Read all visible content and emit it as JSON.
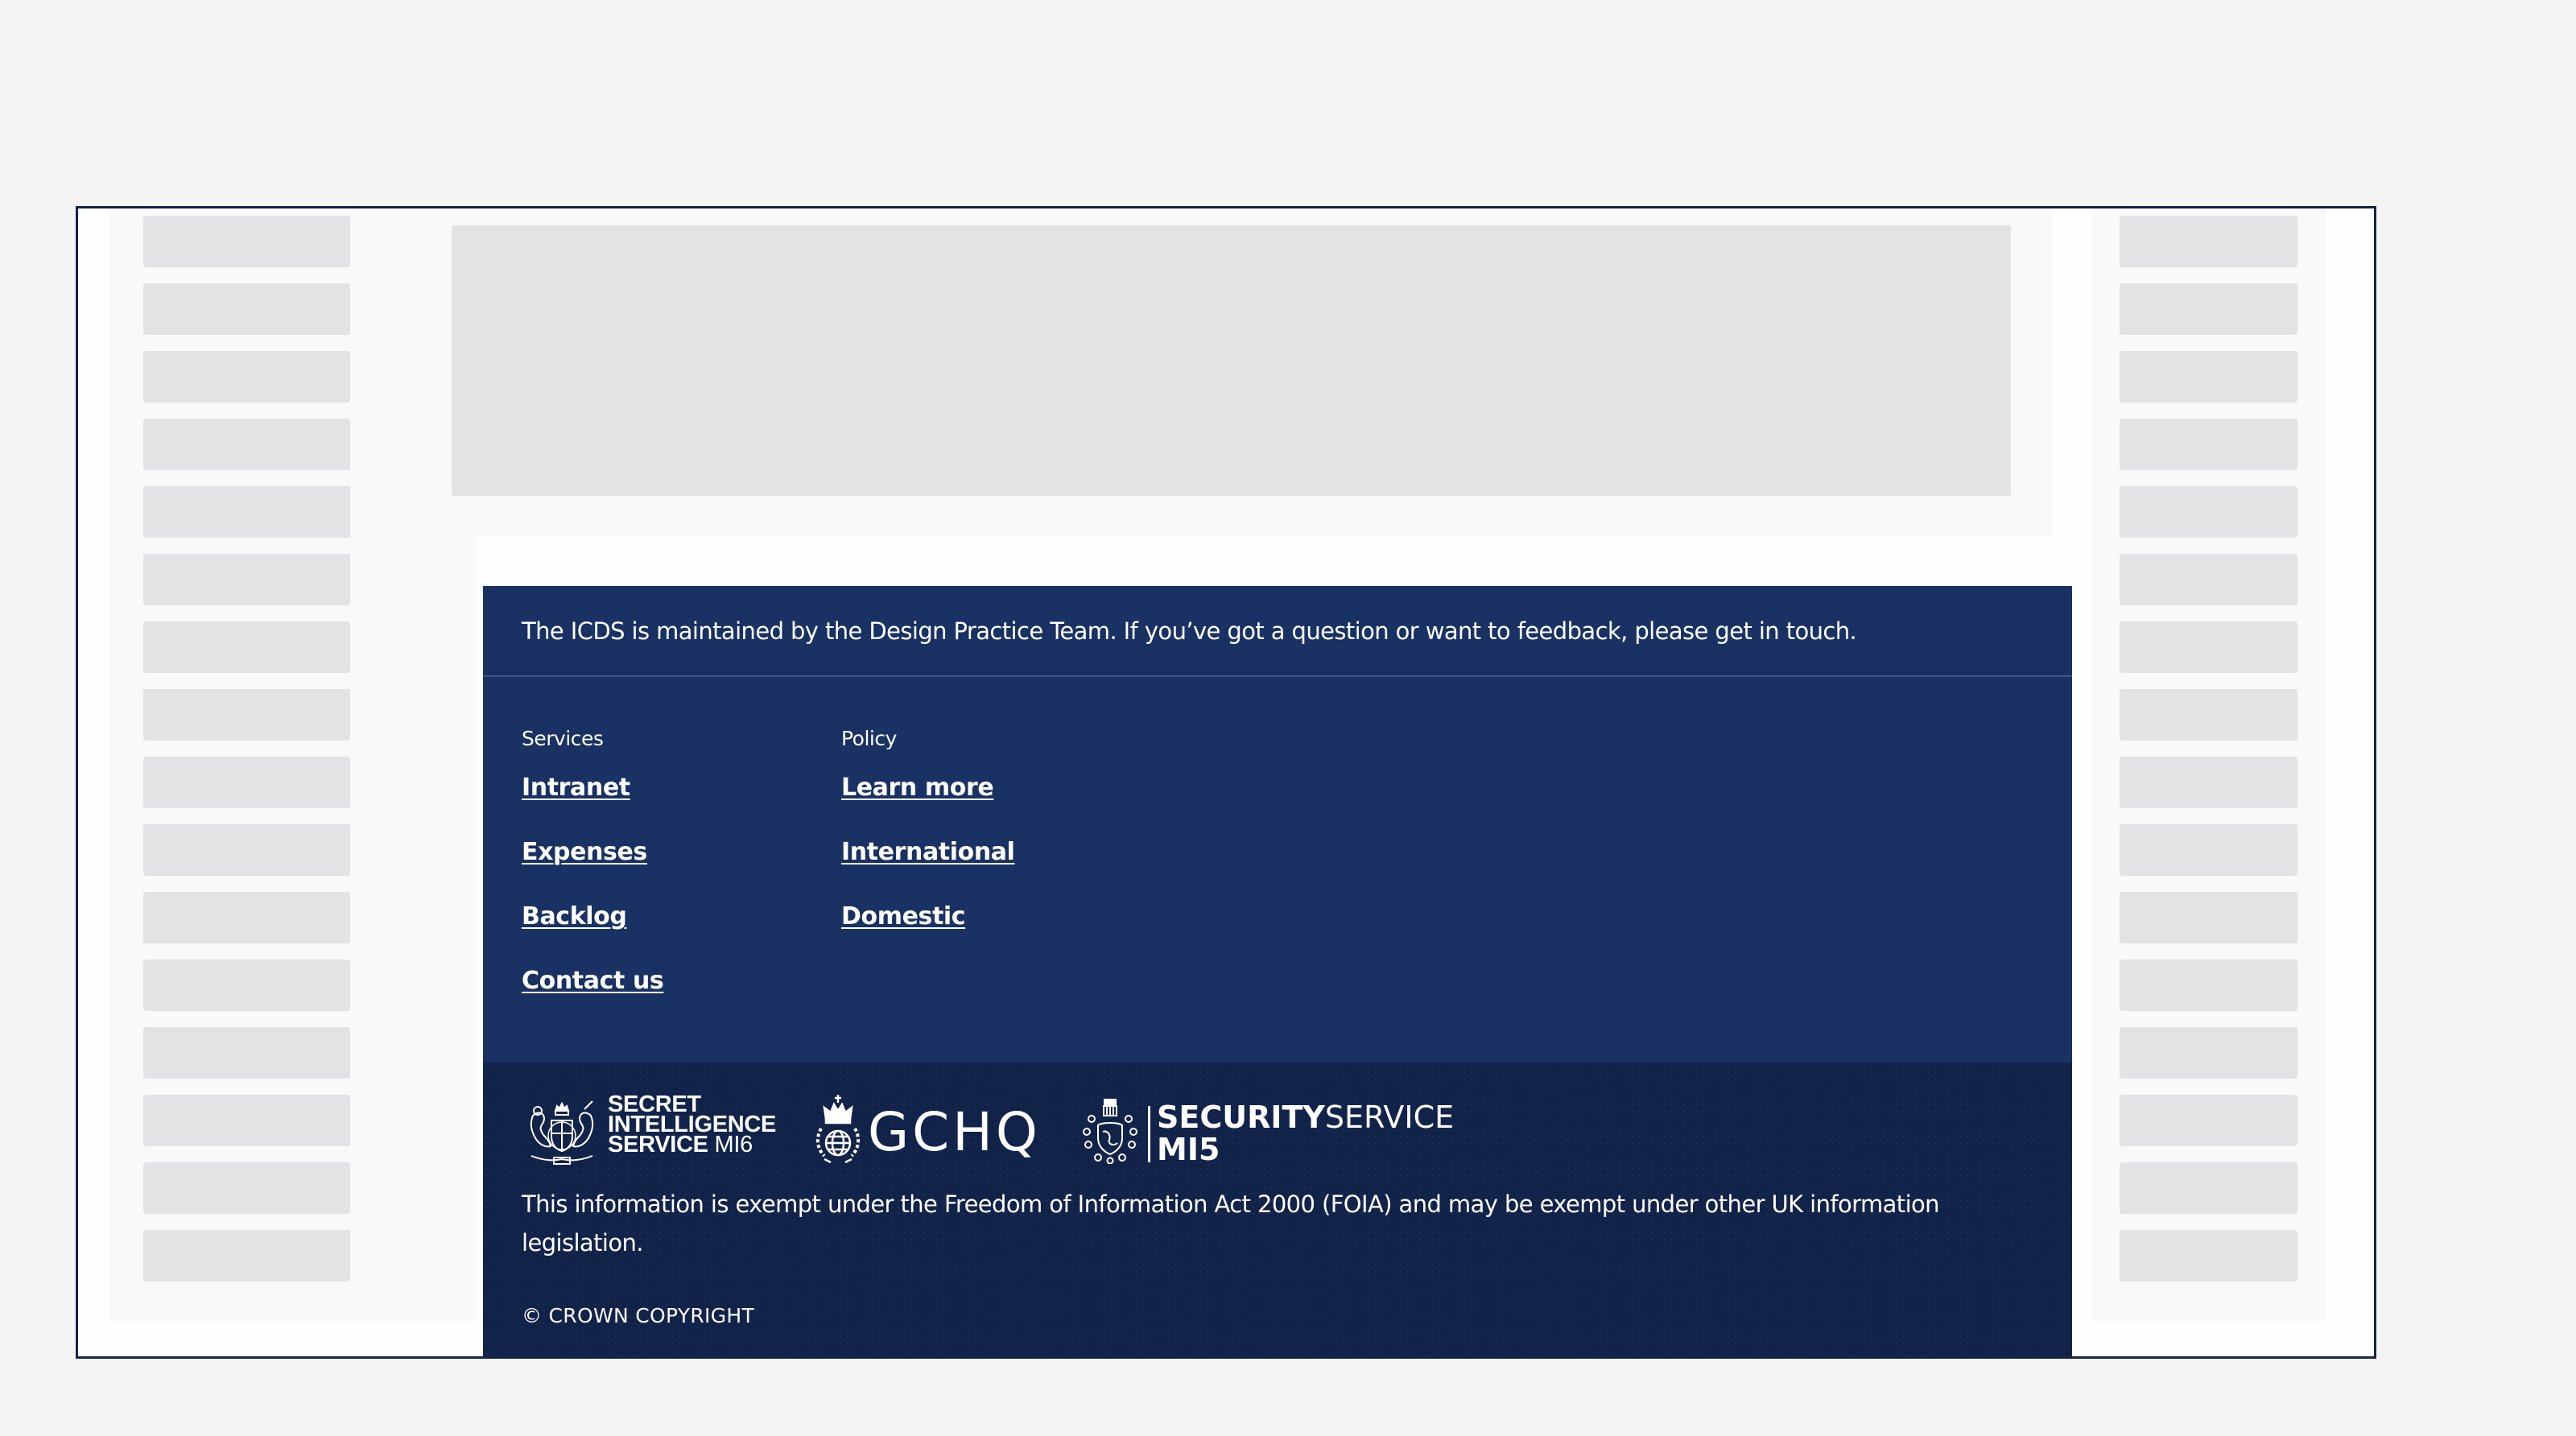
{
  "layout": {
    "left_sidebar_item_count": 16,
    "right_sidebar_item_count": 16
  },
  "colors": {
    "page_background": "#f4f4f4",
    "frame_border": "#14244a",
    "skeleton": "#e2e3e4",
    "footer_primary": "#193163",
    "footer_secondary": "#12234a",
    "footer_text": "#ffffff"
  },
  "footer": {
    "intro": "The ICDS is maintained by the Design Practice Team. If you’ve got a question or want to feedback, please get in touch.",
    "columns": [
      {
        "heading": "Services",
        "links": [
          "Intranet",
          "Expenses",
          "Backlog",
          "Contact us"
        ]
      },
      {
        "heading": "Policy",
        "links": [
          "Learn more",
          "International",
          "Domestic"
        ]
      }
    ],
    "logos": {
      "mi6": {
        "icon": "royal-coat-of-arms-icon",
        "line1": "SECRET",
        "line2": "INTELLIGENCE",
        "line3_bold": "SERVICE",
        "line3_light": "MI6"
      },
      "gchq": {
        "icon": "gchq-crown-globe-icon",
        "text": "GCHQ"
      },
      "mi5": {
        "icon": "security-service-crest-icon",
        "bold": "SECURITY",
        "light": "SERVICE",
        "line2": "MI5"
      }
    },
    "foia": "This information is exempt under the Freedom of Information Act 2000 (FOIA) and may be exempt under other UK information legislation.",
    "copyright": "© CROWN COPYRIGHT"
  }
}
